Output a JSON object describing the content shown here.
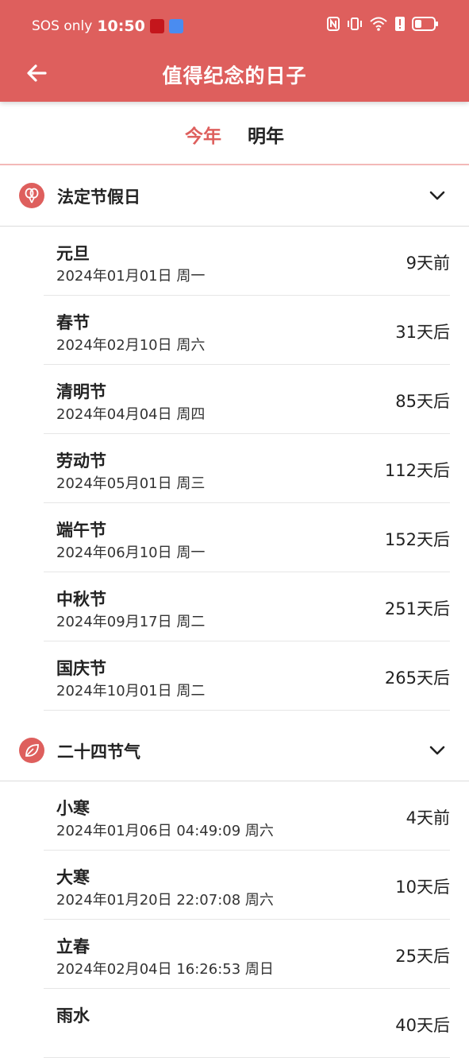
{
  "status": {
    "carrier": "SOS only",
    "time": "10:50"
  },
  "header": {
    "title": "值得纪念的日子"
  },
  "tabs": [
    {
      "label": "今年"
    },
    {
      "label": "明年"
    }
  ],
  "groups": [
    {
      "title": "法定节假日",
      "icon": "balloons-icon",
      "items": [
        {
          "name": "元旦",
          "date": "2024年01月01日 周一",
          "delta": "9天前"
        },
        {
          "name": "春节",
          "date": "2024年02月10日 周六",
          "delta": "31天后"
        },
        {
          "name": "清明节",
          "date": "2024年04月04日 周四",
          "delta": "85天后"
        },
        {
          "name": "劳动节",
          "date": "2024年05月01日 周三",
          "delta": "112天后"
        },
        {
          "name": "端午节",
          "date": "2024年06月10日 周一",
          "delta": "152天后"
        },
        {
          "name": "中秋节",
          "date": "2024年09月17日 周二",
          "delta": "251天后"
        },
        {
          "name": "国庆节",
          "date": "2024年10月01日 周二",
          "delta": "265天后"
        }
      ]
    },
    {
      "title": "二十四节气",
      "icon": "leaf-icon",
      "items": [
        {
          "name": "小寒",
          "date": "2024年01月06日 04:49:09 周六",
          "delta": "4天前"
        },
        {
          "name": "大寒",
          "date": "2024年01月20日 22:07:08 周六",
          "delta": "10天后"
        },
        {
          "name": "立春",
          "date": "2024年02月04日 16:26:53 周日",
          "delta": "25天后"
        },
        {
          "name": "雨水",
          "date": "",
          "delta": "40天后"
        }
      ]
    }
  ],
  "colors": {
    "accent": "#de5f5d",
    "tab_underline": "#f3b9b8"
  }
}
